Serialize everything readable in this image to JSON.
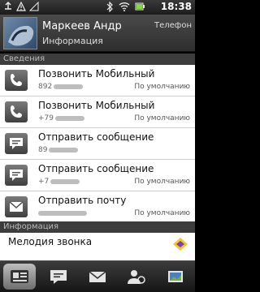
{
  "status_bar": {
    "time": "18:38",
    "icons": [
      "usb-icon",
      "warning-icon",
      "signal-icon",
      "bluetooth-icon",
      "wifi-icon",
      "battery-icon"
    ]
  },
  "header": {
    "name": "Маркеев Андр",
    "subtitle": "Информация",
    "contact_type": "Телефон"
  },
  "sections": {
    "details": "Сведения",
    "info": "Информация"
  },
  "rows": [
    {
      "label": "Позвонить Мобильный",
      "number": "892",
      "default_label": "По умолчанию",
      "icon": "phone-icon"
    },
    {
      "label": "Позвонить Мобильный",
      "number": "+79",
      "default_label": "По умолчанию",
      "icon": "phone-icon"
    },
    {
      "label": "Отправить сообщение",
      "number": "89",
      "default_label": "",
      "icon": "message-icon"
    },
    {
      "label": "Отправить сообщение",
      "number": "+7",
      "default_label": "По умолчанию",
      "icon": "message-icon"
    },
    {
      "label": "Отправить почту",
      "number": "",
      "default_label": "По умолчанию",
      "icon": "mail-icon"
    }
  ],
  "ringtone": {
    "label": "Мелодия звонка"
  },
  "tabs": [
    {
      "name": "details-tab",
      "icon": "contact-card-icon",
      "active": true
    },
    {
      "name": "messages-tab",
      "icon": "message-icon",
      "active": false
    },
    {
      "name": "mail-tab",
      "icon": "mail-icon",
      "active": false
    },
    {
      "name": "updates-tab",
      "icon": "people-icon",
      "active": false
    },
    {
      "name": "history-tab",
      "icon": "history-icon",
      "active": false
    }
  ]
}
